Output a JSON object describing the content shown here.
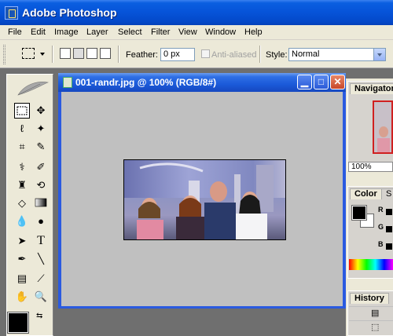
{
  "app": {
    "title": "Adobe Photoshop"
  },
  "menu": [
    "File",
    "Edit",
    "Image",
    "Layer",
    "Select",
    "Filter",
    "View",
    "Window",
    "Help"
  ],
  "options": {
    "feather_label": "Feather:",
    "feather_value": "0 px",
    "antialiased_label": "Anti-aliased",
    "style_label": "Style:",
    "style_value": "Normal"
  },
  "document": {
    "title": "001-randr.jpg @ 100% (RGB/8#)"
  },
  "panels": {
    "navigator_tab": "Navigator",
    "navigator_zoom": "100%",
    "color_tab": "Color",
    "color_tab2": "S",
    "color_channels": [
      "R",
      "G",
      "B"
    ],
    "history_tab": "History"
  },
  "icons": {
    "app": "photoshop-logo-icon",
    "marquee": "rect-marquee-icon",
    "move": "move-icon",
    "lasso": "lasso-icon",
    "magic_wand": "magic-wand-icon",
    "crop": "crop-icon",
    "eyedropper": "eyedropper-icon"
  },
  "colors": {
    "titlebar": "#0653d8",
    "workspace": "#6f6f6f",
    "canvas": "#c0c0c0"
  }
}
